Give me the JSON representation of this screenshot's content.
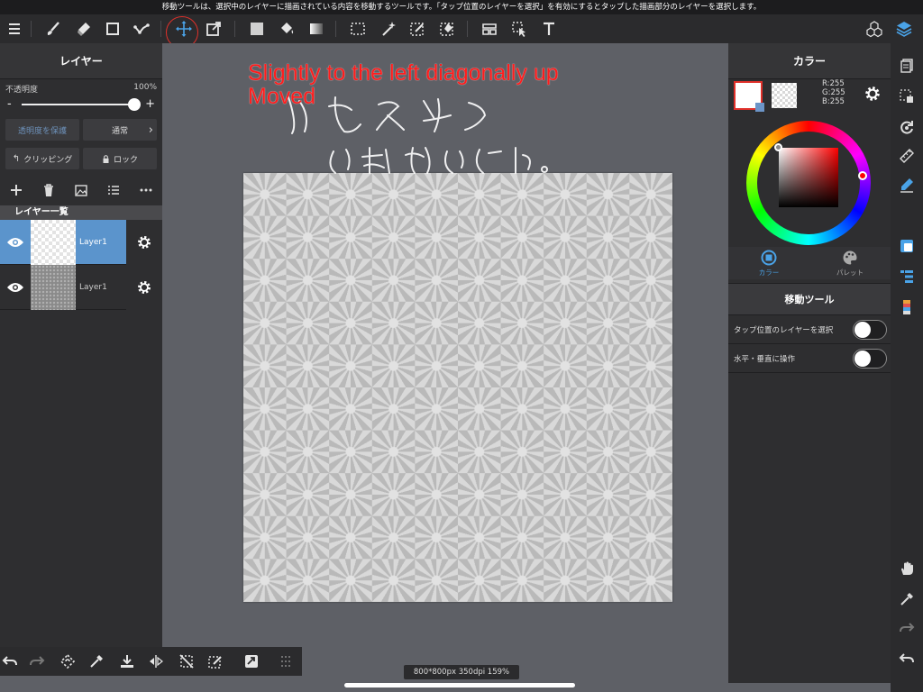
{
  "hint": "移動ツールは、選択中のレイヤーに描画されている内容を移動するツールです。「タップ位置のレイヤーを選択」を有効にするとタップした描画部分のレイヤーを選択します。",
  "colors": {
    "accent": "#4aa3e8",
    "selected_layer": "#5b94cc",
    "annotation": "#ff1c1c"
  },
  "toolbar": {
    "icons": [
      "menu-icon",
      "brush-icon",
      "eraser-icon",
      "shape-icon",
      "polyline-icon",
      "move-icon",
      "transform-icon",
      "fill-color-icon",
      "bucket-icon",
      "gradient-icon",
      "selection-icon",
      "magic-wand-icon",
      "select-pen-icon",
      "select-eraser-icon",
      "panel-layout-icon",
      "operation-icon",
      "text-icon",
      "3d-cube-icon",
      "layers-icon"
    ],
    "active_tool": "move-icon"
  },
  "layer_panel": {
    "title": "レイヤー",
    "opacity_label": "不透明度",
    "opacity_value": "100%",
    "opacity_fraction": 1.0,
    "minus": "-",
    "plus": "+",
    "protect_alpha": "透明度を保護",
    "blend_mode": "通常",
    "clipping": "クリッピング",
    "lock": "ロック",
    "list_title": "レイヤー一覧",
    "layers": [
      {
        "name": "Layer1",
        "selected": true
      },
      {
        "name": "Layer1",
        "selected": false
      }
    ]
  },
  "canvas": {
    "annotation_line1": "Slightly to the left diagonally up",
    "annotation_line2": "Moved",
    "status": "800*800px 350dpi 159%"
  },
  "color_panel": {
    "title": "カラー",
    "r": "R:255",
    "g": "G:255",
    "b": "B:255",
    "tab_color": "カラー",
    "tab_palette": "パレット"
  },
  "move_tool": {
    "title": "移動ツール",
    "option1": "タップ位置のレイヤーを選択",
    "option1_on": false,
    "option2": "水平・垂直に操作",
    "option2_on": false
  }
}
